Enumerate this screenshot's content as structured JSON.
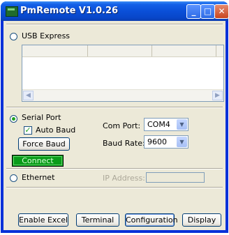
{
  "window": {
    "title": "PmRemote  V1.0.26"
  },
  "usb": {
    "label": "USB Express"
  },
  "serial": {
    "label": "Serial Port",
    "auto_baud_label": "Auto Baud",
    "force_baud_label": "Force Baud",
    "connect_label": "Connect",
    "com_port_label": "Com Port:",
    "com_port_value": "COM4",
    "baud_rate_label": "Baud Rate:",
    "baud_rate_value": "9600"
  },
  "ethernet": {
    "label": "Ethernet",
    "ip_label": "IP Address:",
    "ip_value": ""
  },
  "buttons": {
    "enable_excel": "Enable Excel",
    "terminal": "Terminal",
    "configuration": "Configuration",
    "display": "Display"
  },
  "icons": {
    "scroll_left": "◀",
    "scroll_right": "▶",
    "combo_arrow": "▼",
    "check": "✓"
  },
  "colors": {
    "connect_bg": "#0a9c1a",
    "title_bar": "#0a4fd8"
  }
}
